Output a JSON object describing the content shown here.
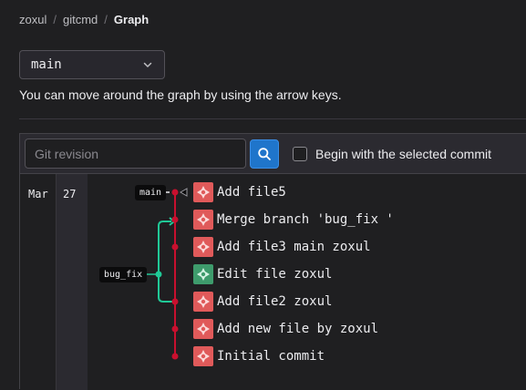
{
  "breadcrumb": {
    "owner": "zoxul",
    "repo": "gitcmd",
    "current": "Graph"
  },
  "branch_select": {
    "value": "main"
  },
  "hint": "You can move around the graph by using the arrow keys.",
  "toolbar": {
    "revision_placeholder": "Git revision",
    "search_icon": "search-icon",
    "checkbox_label": "Begin with the selected commit",
    "checkbox_checked": false
  },
  "dates": {
    "month": "Mar",
    "day": "27"
  },
  "refs": {
    "main": "main",
    "bug_fix": "bug_fix"
  },
  "commits": [
    {
      "message": "Add file5",
      "avatar": "red"
    },
    {
      "message": "Merge branch 'bug_fix '",
      "avatar": "red"
    },
    {
      "message": "Add file3 main zoxul",
      "avatar": "red"
    },
    {
      "message": "Edit file zoxul",
      "avatar": "green"
    },
    {
      "message": "Add file2 zoxul",
      "avatar": "red"
    },
    {
      "message": "Add new file by zoxul",
      "avatar": "red"
    },
    {
      "message": "Initial commit",
      "avatar": "red"
    }
  ],
  "colors": {
    "main_line": "#c8102e",
    "branch_line": "#20c997",
    "accent": "#1f75cb",
    "avatar_red": "#e05a5a",
    "avatar_green": "#3e9b6c"
  }
}
